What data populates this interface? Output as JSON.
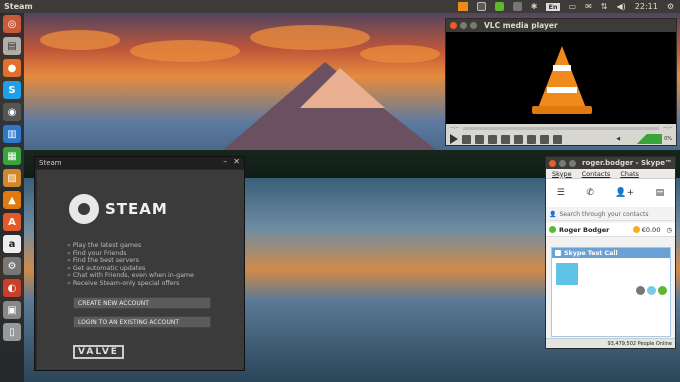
{
  "topbar": {
    "app_name": "Steam",
    "clock": "22:11",
    "lang": "En"
  },
  "launcher": {
    "items": [
      "Dash",
      "Files",
      "Firefox",
      "Skype",
      "Steam",
      "Writer",
      "Calc",
      "Impress",
      "VLC",
      "Software Center",
      "Amazon",
      "System Settings",
      "Ubuntu One",
      "Workspaces",
      "Trash"
    ]
  },
  "steam": {
    "window_title": "Steam",
    "logo_text": "STEAM",
    "features": [
      "Play the latest games",
      "Find your Friends",
      "Find the best servers",
      "Get automatic updates",
      "Chat with Friends, even when in-game",
      "Receive Steam-only special offers"
    ],
    "create_account_label": "CREATE NEW ACCOUNT",
    "login_label": "LOGIN TO AN EXISTING ACCOUNT",
    "valve_logo": "VALVE"
  },
  "vlc": {
    "window_title": "VLC media player",
    "time_left": "--:--",
    "time_right": "--:--",
    "volume": "0%"
  },
  "skype": {
    "window_title": "roger.bodger - Skype™",
    "menu": [
      "Skype",
      "Contacts",
      "Chats"
    ],
    "search_placeholder": "Search through your contacts",
    "user_name": "Roger Bodger",
    "credit": "€0.00",
    "test_call_label": "Skype Test Call",
    "people_online": "93,479,502 People Online"
  },
  "colors": {
    "panel": "#3c3b37",
    "vlc_orange": "#f08a1c",
    "skype_blue": "#6aa1d6",
    "skype_green": "#5cb82e"
  }
}
